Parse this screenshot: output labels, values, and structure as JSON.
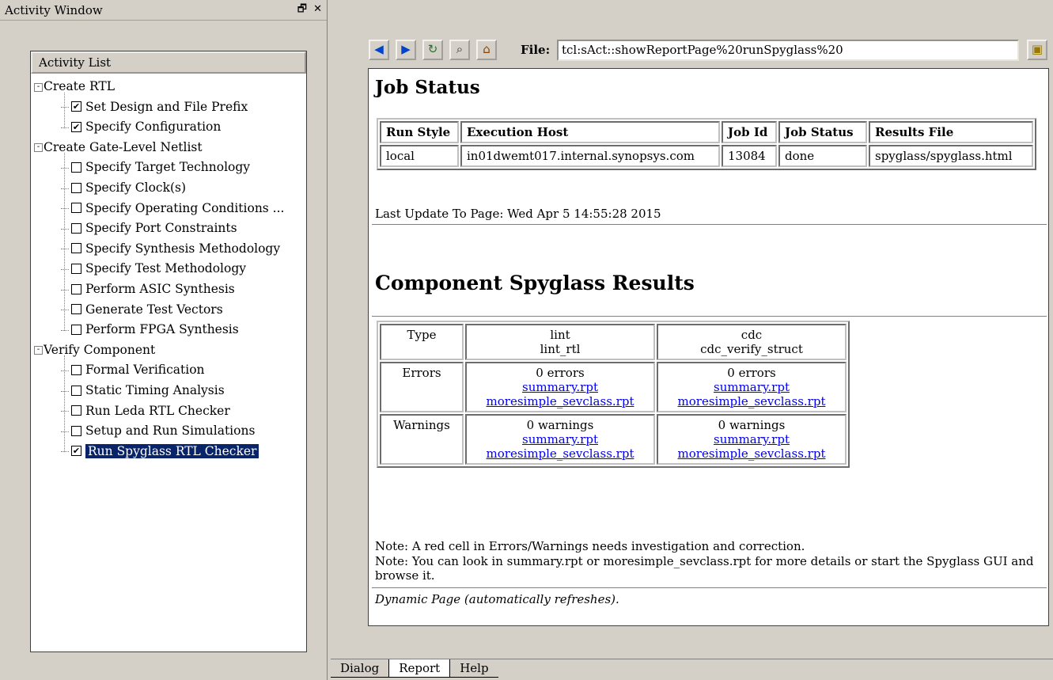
{
  "window": {
    "title": "Activity Window",
    "float_icon": "restore-icon",
    "close_icon": "close-icon",
    "float_glyph": "🗗",
    "close_glyph": "✕"
  },
  "activity_list": {
    "header": "Activity List",
    "groups": [
      {
        "label": "Create RTL",
        "items": [
          {
            "label": "Set Design and File Prefix",
            "checked": true
          },
          {
            "label": "Specify Configuration",
            "checked": true
          }
        ]
      },
      {
        "label": "Create Gate-Level Netlist",
        "items": [
          {
            "label": "Specify Target Technology",
            "checked": false
          },
          {
            "label": "Specify Clock(s)",
            "checked": false
          },
          {
            "label": "Specify Operating Conditions ...",
            "checked": false
          },
          {
            "label": "Specify Port Constraints",
            "checked": false
          },
          {
            "label": "Specify Synthesis Methodology",
            "checked": false
          },
          {
            "label": "Specify Test Methodology",
            "checked": false
          },
          {
            "label": "Perform ASIC Synthesis",
            "checked": false
          },
          {
            "label": "Generate Test Vectors",
            "checked": false
          },
          {
            "label": "Perform FPGA Synthesis",
            "checked": false
          }
        ]
      },
      {
        "label": "Verify Component",
        "items": [
          {
            "label": "Formal Verification",
            "checked": false
          },
          {
            "label": "Static Timing Analysis",
            "checked": false
          },
          {
            "label": "Run Leda RTL Checker",
            "checked": false
          },
          {
            "label": "Setup and Run Simulations",
            "checked": false
          },
          {
            "label": "Run Spyglass RTL Checker",
            "checked": true,
            "selected": true
          }
        ]
      }
    ]
  },
  "toolbar": {
    "buttons": [
      {
        "icon": "back-arrow-icon",
        "glyph": "◀"
      },
      {
        "icon": "forward-arrow-icon",
        "glyph": "▶"
      },
      {
        "icon": "refresh-icon",
        "glyph": "↻"
      },
      {
        "icon": "search-icon",
        "glyph": "⌕"
      },
      {
        "icon": "home-icon",
        "glyph": "⌂"
      }
    ],
    "file_label": "File:",
    "file_value": "tcl:sAct::showReportPage%20runSpyglass%20",
    "go_icon": "load-page-icon",
    "go_glyph": "▣"
  },
  "report": {
    "job_status_title": "Job Status",
    "job_table": {
      "headers": [
        "Run Style",
        "Execution Host",
        "Job Id",
        "Job Status",
        "Results File"
      ],
      "row": [
        "local",
        "in01dwemt017.internal.synopsys.com",
        "13084",
        "done",
        "spyglass/spyglass.html"
      ]
    },
    "last_update": "Last Update To Page: Wed Apr 5 14:55:28 2015",
    "component_title": "Component Spyglass Results",
    "comp_table": {
      "type_label": "Type",
      "errors_label": "Errors",
      "warnings_label": "Warnings",
      "columns": [
        {
          "type": "lint",
          "subtype": "lint_rtl",
          "errors": "0 errors",
          "warnings": "0 warnings"
        },
        {
          "type": "cdc",
          "subtype": "cdc_verify_struct",
          "errors": "0 errors",
          "warnings": "0 warnings"
        }
      ],
      "link_summary": "summary.rpt",
      "link_sevclass": "moresimple_sevclass.rpt"
    },
    "note1": "Note: A red cell in Errors/Warnings needs investigation and correction.",
    "note2": "Note: You can look in summary.rpt or moresimple_sevclass.rpt for more details or start the Spyglass GUI and browse it.",
    "footer": "Dynamic Page (automatically refreshes)."
  },
  "tabs": [
    {
      "label": "Dialog",
      "active": false
    },
    {
      "label": "Report",
      "active": true
    },
    {
      "label": "Help",
      "active": false
    }
  ],
  "colors": {
    "selection_bg": "#0a246a",
    "link": "#0000ee",
    "panel_bg": "#d4d0c8"
  }
}
